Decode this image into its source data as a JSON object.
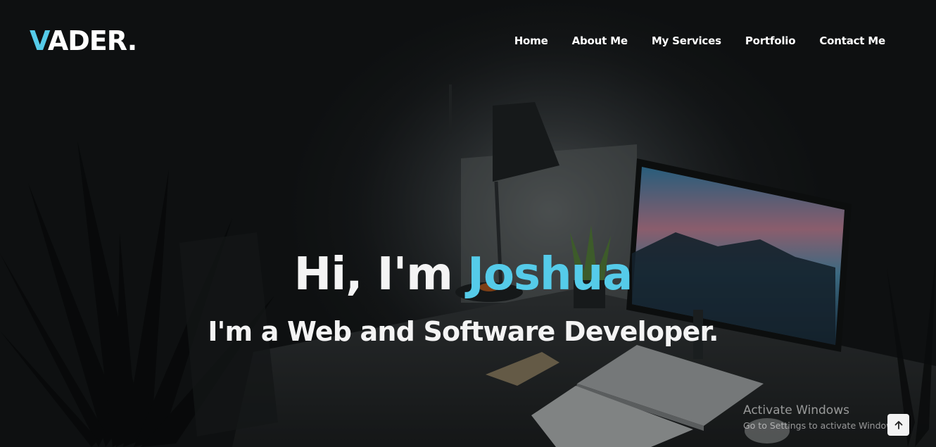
{
  "brand": {
    "logo_initial": "V",
    "logo_rest": "ADER.",
    "accent_color": "#55cbe9"
  },
  "nav": {
    "items": [
      {
        "label": "Home"
      },
      {
        "label": "About Me"
      },
      {
        "label": "My Services"
      },
      {
        "label": "Portfolio"
      },
      {
        "label": "Contact Me"
      }
    ]
  },
  "hero": {
    "greeting": "Hi, I'm ",
    "name": "Joshua",
    "tagline": "I'm a Web and Software Developer."
  },
  "os_watermark": {
    "title": "Activate Windows",
    "subtitle": "Go to Settings to activate Windows."
  },
  "scroll_top": {
    "icon": "arrow-up-icon"
  }
}
